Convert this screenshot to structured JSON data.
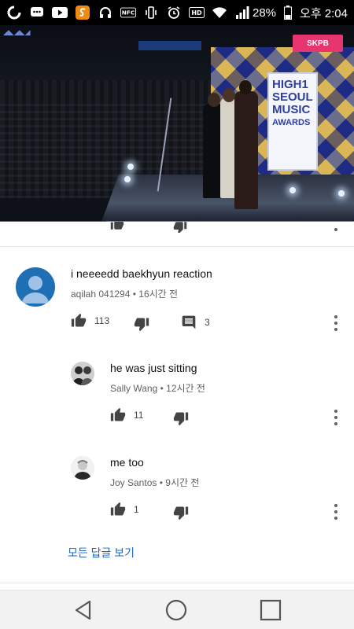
{
  "status_bar": {
    "battery": "28%",
    "time": "오후 2:04",
    "nfc_label": "NFC",
    "hd_label": "HD"
  },
  "video": {
    "sign_lines": [
      "HIGH1",
      "SEOUL",
      "MUSIC",
      "AWARDS"
    ],
    "badge_text": "SKPB",
    "progress_fraction": 0.3
  },
  "comments": [
    {
      "text": "i neeeedd baekhyun reaction",
      "author": "aqilah 041294",
      "time": "16시간 전",
      "likes": "113",
      "replies": "3"
    },
    {
      "text": "he was just sitting",
      "author": "Sally Wang",
      "time": "12시간 전",
      "likes": "11"
    },
    {
      "text": "me too",
      "author": "Joy Santos",
      "time": "9시간 전",
      "likes": "1"
    }
  ],
  "view_all_replies": "모든 답글 보기",
  "colors": {
    "accent_link": "#1a66c7",
    "progress": "#e31c1c",
    "avatar_default": "#1e6fb3"
  }
}
